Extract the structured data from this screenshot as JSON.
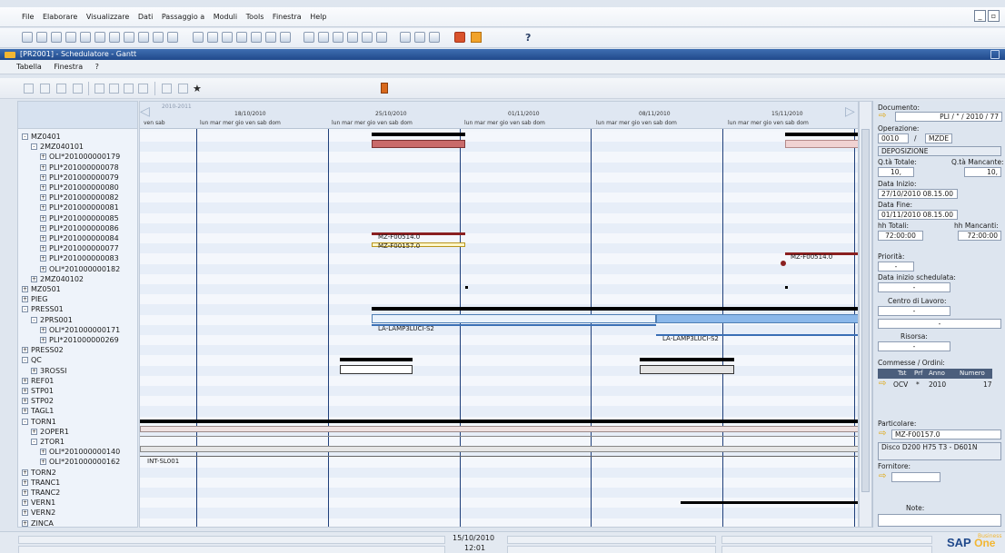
{
  "main_menu": [
    "File",
    "Elaborare",
    "Visualizzare",
    "Dati",
    "Passaggio a",
    "Moduli",
    "Tools",
    "Finestra",
    "Help"
  ],
  "window": {
    "title": "[PR2001] - Schedulatore - Gantt"
  },
  "sub_menu": [
    "Tabella",
    "Finestra",
    "?"
  ],
  "gantt_header": {
    "year_label": "2010-2011",
    "weeks": [
      "18/10/2010",
      "25/10/2010",
      "01/11/2010",
      "08/11/2010",
      "15/11/2010"
    ],
    "days_week": "lun  mar  mer  gio  ven  sab  dom",
    "days_first": "ven  sab"
  },
  "tree": [
    {
      "toggle": "-",
      "label": "MZ0401",
      "level": 0
    },
    {
      "toggle": "-",
      "label": "2MZ040101",
      "level": 1
    },
    {
      "toggle": "+",
      "label": "OLI*201000000179",
      "level": 2
    },
    {
      "toggle": "+",
      "label": "PLI*201000000078",
      "level": 2
    },
    {
      "toggle": "+",
      "label": "PLI*201000000079",
      "level": 2
    },
    {
      "toggle": "+",
      "label": "PLI*201000000080",
      "level": 2
    },
    {
      "toggle": "+",
      "label": "PLI*201000000082",
      "level": 2
    },
    {
      "toggle": "+",
      "label": "PLI*201000000081",
      "level": 2
    },
    {
      "toggle": "+",
      "label": "PLI*201000000085",
      "level": 2
    },
    {
      "toggle": "+",
      "label": "PLI*201000000086",
      "level": 2
    },
    {
      "toggle": "+",
      "label": "PLI*201000000084",
      "level": 2
    },
    {
      "toggle": "+",
      "label": "PLI*201000000077",
      "level": 2
    },
    {
      "toggle": "+",
      "label": "PLI*201000000083",
      "level": 2
    },
    {
      "toggle": "+",
      "label": "OLI*201000000182",
      "level": 2
    },
    {
      "toggle": "+",
      "label": "2MZ040102",
      "level": 1
    },
    {
      "toggle": "+",
      "label": "MZ0501",
      "level": 0
    },
    {
      "toggle": "+",
      "label": "PIEG",
      "level": 0
    },
    {
      "toggle": "-",
      "label": "PRESS01",
      "level": 0
    },
    {
      "toggle": "-",
      "label": "2PRS001",
      "level": 1
    },
    {
      "toggle": "+",
      "label": "OLI*201000000171",
      "level": 2
    },
    {
      "toggle": "+",
      "label": "PLI*201000000269",
      "level": 2
    },
    {
      "toggle": "+",
      "label": "PRESS02",
      "level": 0
    },
    {
      "toggle": "-",
      "label": "QC",
      "level": 0
    },
    {
      "toggle": "+",
      "label": "3ROSSI",
      "level": 1
    },
    {
      "toggle": "+",
      "label": "REF01",
      "level": 0
    },
    {
      "toggle": "+",
      "label": "STP01",
      "level": 0
    },
    {
      "toggle": "+",
      "label": "STP02",
      "level": 0
    },
    {
      "toggle": "+",
      "label": "TAGL1",
      "level": 0
    },
    {
      "toggle": "-",
      "label": "TORN1",
      "level": 0
    },
    {
      "toggle": "+",
      "label": "2OPER1",
      "level": 1
    },
    {
      "toggle": "-",
      "label": "2TOR1",
      "level": 1
    },
    {
      "toggle": "+",
      "label": "OLI*201000000140",
      "level": 2
    },
    {
      "toggle": "+",
      "label": "OLI*201000000162",
      "level": 2
    },
    {
      "toggle": "+",
      "label": "TORN2",
      "level": 0
    },
    {
      "toggle": "+",
      "label": "TRANC1",
      "level": 0
    },
    {
      "toggle": "+",
      "label": "TRANC2",
      "level": 0
    },
    {
      "toggle": "+",
      "label": "VERN1",
      "level": 0
    },
    {
      "toggle": "+",
      "label": "VERN2",
      "level": 0
    },
    {
      "toggle": "+",
      "label": "ZINCA",
      "level": 0
    }
  ],
  "gantt_labels": {
    "mz_a": "MZ-F00514.0",
    "mz_b": "MZ-F00157.0",
    "mz_c": "MZ-F00514.0",
    "la_a": "LA-LAMP3LUCI-S2",
    "la_b": "LA-LAMP3LUCI-S2",
    "int": "INT-SL001"
  },
  "details": {
    "documento_label": "Documento:",
    "documento_value": "PLI / \" / 2010 / 77",
    "operazione_label": "Operazione:",
    "op_num": "0010",
    "op_sep": "/",
    "op_code": "MZDE",
    "op_desc": "DEPOSIZIONE",
    "qta_totale_label": "Q.tà Totale:",
    "qta_totale": "10,",
    "qta_mancante_label": "Q.tà Mancante:",
    "qta_mancante": "10,",
    "data_inizio_label": "Data Inizio:",
    "data_inizio": "27/10/2010 08.15.00",
    "data_fine_label": "Data Fine:",
    "data_fine": "01/11/2010 08.15.00",
    "hh_totali_label": "hh Totali:",
    "hh_totali": "72:00:00",
    "hh_mancanti_label": "hh Mancanti:",
    "hh_mancanti": "72:00:00",
    "priorita_label": "Priorità:",
    "priorita_value": "-",
    "data_sched_label": "Data inizio schedulata:",
    "data_sched_value": "-",
    "centro_label": "Centro di Lavoro:",
    "centro_value": "-",
    "centro_desc": "-",
    "risorsa_label": "Risorsa:",
    "risorsa_value": "-",
    "commesse_label": "Commesse / Ordini:",
    "commesse_cols": [
      "Tst",
      "Prf",
      "Anno",
      "Numero"
    ],
    "commessa_row": {
      "tst": "OCV",
      "prf": "*",
      "anno": "2010",
      "numero": "17"
    },
    "particolare_label": "Particolare:",
    "particolare_value": "MZ-F00157.0",
    "particolare_desc": "Disco D200 H75 T3 - D601N",
    "fornitore_label": "Fornitore:",
    "note_label": "Note:"
  },
  "status": {
    "date": "15/10/2010",
    "time": "12:01"
  },
  "brand": {
    "sap": "SAP",
    "one": "One",
    "business": "Business"
  },
  "colors": {
    "selection_bar": "#c96a6a",
    "light_red": "#f0d2d2",
    "blue_bar": "#8bb8ea",
    "title_bar": "#20498b"
  }
}
